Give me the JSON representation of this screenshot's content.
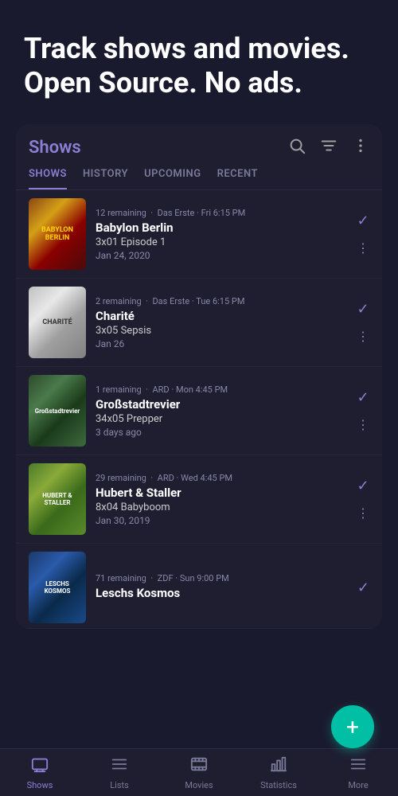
{
  "hero": {
    "title": "Track shows and movies. Open Source. No ads."
  },
  "card": {
    "title": "Shows",
    "tabs": [
      {
        "label": "SHOWS",
        "active": true
      },
      {
        "label": "HISTORY",
        "active": false
      },
      {
        "label": "UPCOMING",
        "active": false
      },
      {
        "label": "RECENT",
        "active": false
      }
    ],
    "shows": [
      {
        "remaining": "12 remaining",
        "channel": "Das Erste",
        "time": "Fri 6:15 PM",
        "name": "Babylon Berlin",
        "episode": "3x01 Episode 1",
        "date": "Jan 24, 2020",
        "poster_label": "BABYLON BERLIN"
      },
      {
        "remaining": "2 remaining",
        "channel": "Das Erste",
        "time": "Tue 6:15 PM",
        "name": "Charité",
        "episode": "3x05 Sepsis",
        "date": "Jan 26",
        "poster_label": "CHARITÉ"
      },
      {
        "remaining": "1 remaining",
        "channel": "ARD",
        "time": "Mon 4:45 PM",
        "name": "Großstadtrevier",
        "episode": "34x05 Prepper",
        "date": "3 days ago",
        "poster_label": "Großstadt­revier"
      },
      {
        "remaining": "29 remaining",
        "channel": "ARD",
        "time": "Wed 4:45 PM",
        "name": "Hubert & Staller",
        "episode": "8x04 Babyboom",
        "date": "Jan 30, 2019",
        "poster_label": "HUBERT & STALLER"
      },
      {
        "remaining": "71 remaining",
        "channel": "ZDF",
        "time": "Sun 9:00 PM",
        "name": "Leschs Kosmos",
        "episode": "",
        "date": "",
        "poster_label": "LESCHS KOSMOS"
      }
    ]
  },
  "fab": {
    "label": "+"
  },
  "nav": {
    "items": [
      {
        "label": "Shows",
        "active": true
      },
      {
        "label": "Lists",
        "active": false
      },
      {
        "label": "Movies",
        "active": false
      },
      {
        "label": "Statistics",
        "active": false
      },
      {
        "label": "More",
        "active": false
      }
    ]
  }
}
